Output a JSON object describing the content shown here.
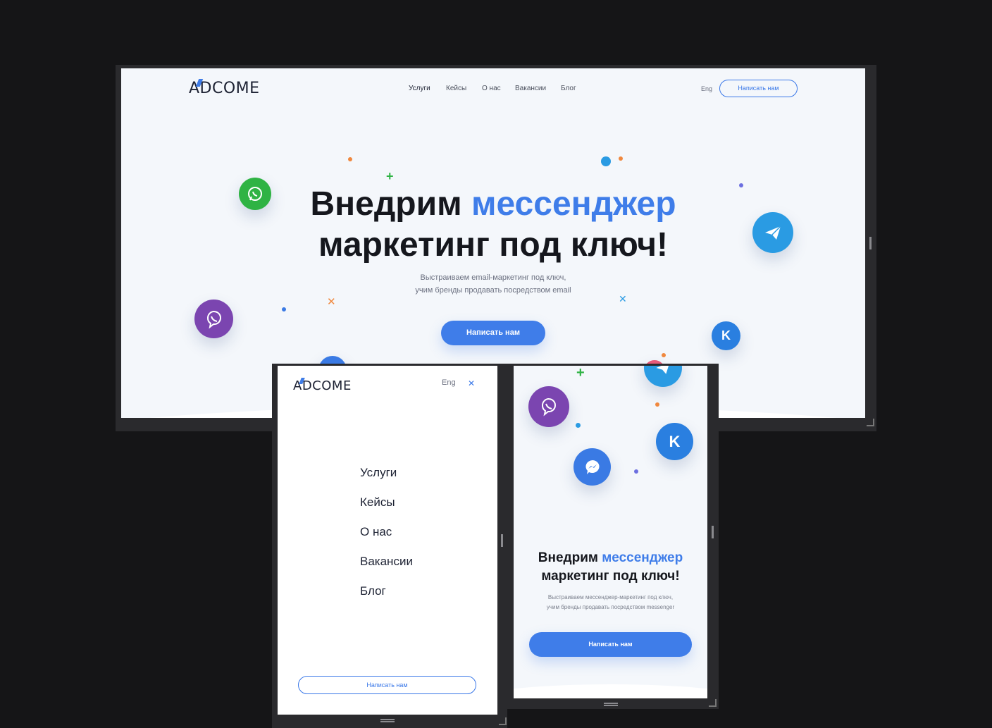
{
  "brand": {
    "logo_text": "ADCOME"
  },
  "desktop": {
    "nav": [
      "Услуги",
      "Кейсы",
      "О нас",
      "Вакансии",
      "Блог"
    ],
    "lang": "Eng",
    "header_cta": "Написать нам",
    "hero": {
      "title_part1": "Внедрим ",
      "title_accent": "мессенджер",
      "title_line2": "маркетинг под ключ!",
      "subtitle_line1": "Выстраиваем email-маркетинг под ключ,",
      "subtitle_line2": "учим бренды продавать посредством email",
      "cta": "Написать нам"
    }
  },
  "mobile_menu": {
    "lang": "Eng",
    "close_glyph": "✕",
    "items": [
      "Услуги",
      "Кейсы",
      "О нас",
      "Вакансии",
      "Блог"
    ],
    "cta": "Написать нам"
  },
  "mobile_hero": {
    "title_part1": "Внедрим ",
    "title_accent": "мессенджер",
    "title_line2": "маркетинг под ключ!",
    "subtitle_line1": "Выстраиваем мессенджер-маркетинг под ключ,",
    "subtitle_line2": "учим бренды продавать посредством messenger",
    "cta": "Написать нам"
  },
  "colors": {
    "accent": "#3f7de9",
    "whatsapp": "#2fb344",
    "telegram": "#2a9be3",
    "viber": "#7b45b0",
    "vk": "#2a7fe0",
    "messenger": "#3a7ae4",
    "orange": "#f0883e",
    "green_plus": "#2fb344"
  }
}
